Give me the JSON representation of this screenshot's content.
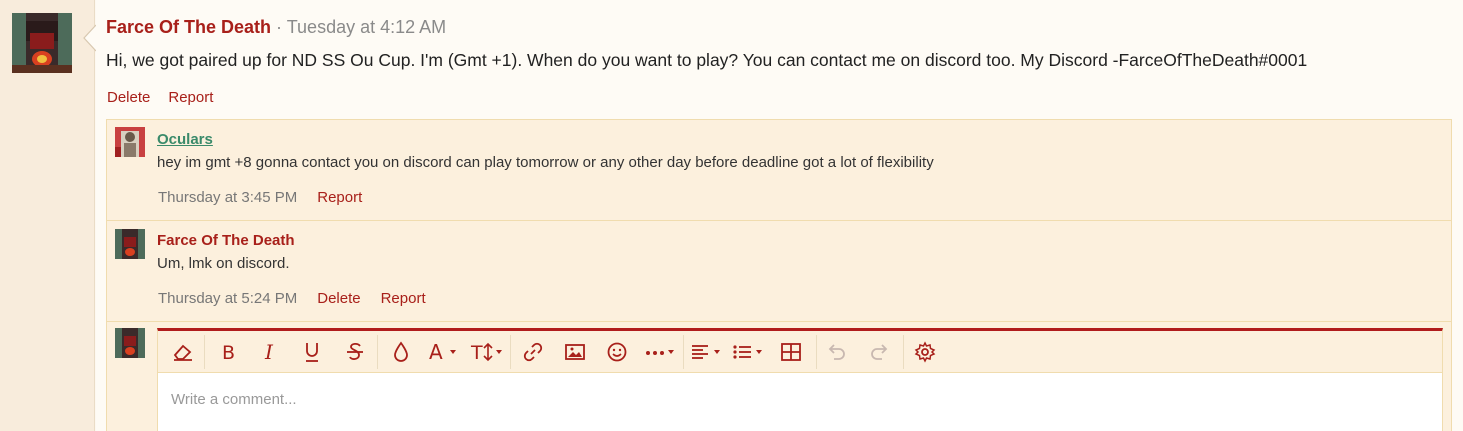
{
  "post": {
    "author": "Farce Of The Death",
    "separator": " · ",
    "time": "Tuesday at 4:12 AM",
    "body": "Hi, we got paired up for ND SS Ou Cup. I'm (Gmt +1). When do you want to play? You can contact me on discord too. My Discord -FarceOfTheDeath#0001",
    "actions": {
      "delete": "Delete",
      "report": "Report"
    }
  },
  "comments": [
    {
      "author": "Oculars",
      "text": "hey im gmt +8 gonna contact you on discord can play tomorrow or any other day before deadline got a lot of flexibility",
      "time": "Thursday at 3:45 PM",
      "report": "Report"
    },
    {
      "author": "Farce Of The Death",
      "text": "Um, lmk on discord.",
      "time": "Thursday at 5:24 PM",
      "delete": "Delete",
      "report": "Report"
    }
  ],
  "editor": {
    "placeholder": "Write a comment...",
    "toolbar": [
      "eraser-icon",
      "bold-icon",
      "italic-icon",
      "underline-icon",
      "strikethrough-icon",
      "text-color-icon",
      "font-family-icon",
      "font-size-icon",
      "link-icon",
      "image-icon",
      "emoji-icon",
      "more-icon",
      "align-icon",
      "list-icon",
      "table-icon",
      "undo-icon",
      "redo-icon",
      "settings-icon"
    ]
  },
  "colors": {
    "accent": "#a8201a",
    "link_green": "#3a8a6a",
    "comment_bg": "#fcf0dd",
    "page_bg": "#fdf8f0"
  }
}
